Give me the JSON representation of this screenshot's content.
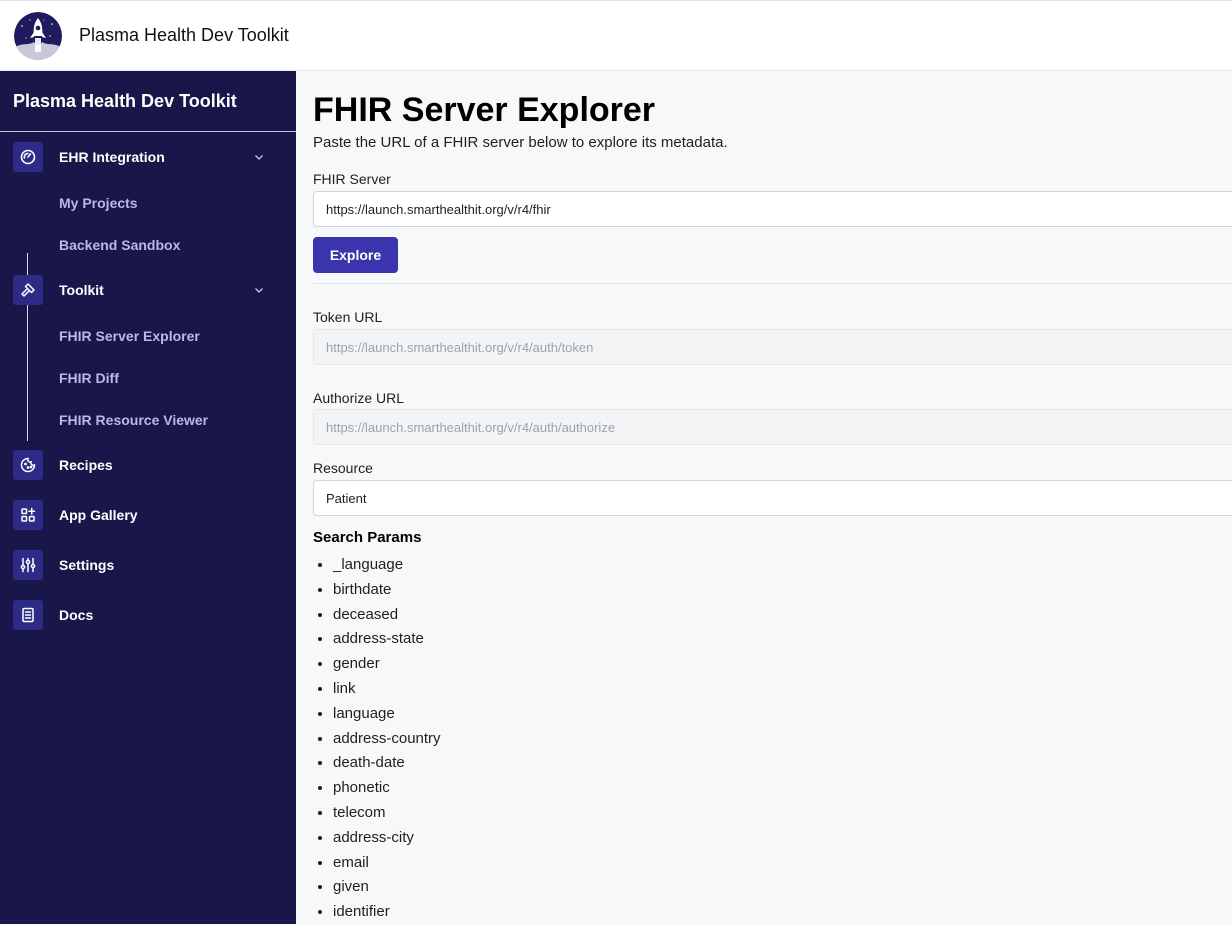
{
  "topbar": {
    "title": "Plasma Health Dev Toolkit",
    "logo_icon": "rocket-logo-icon"
  },
  "sidebar": {
    "brand": "Plasma Health Dev Toolkit",
    "groups": [
      {
        "label": "EHR Integration",
        "icon": "gauge-icon",
        "expanded": true,
        "children": [
          {
            "label": "My Projects"
          },
          {
            "label": "Backend Sandbox"
          }
        ]
      },
      {
        "label": "Toolkit",
        "icon": "hammer-icon",
        "expanded": true,
        "children": [
          {
            "label": "FHIR Server Explorer"
          },
          {
            "label": "FHIR Diff"
          },
          {
            "label": "FHIR Resource Viewer"
          }
        ]
      }
    ],
    "items": [
      {
        "label": "Recipes",
        "icon": "cookie-icon"
      },
      {
        "label": "App Gallery",
        "icon": "grid-plus-icon"
      },
      {
        "label": "Settings",
        "icon": "sliders-icon"
      },
      {
        "label": "Docs",
        "icon": "document-icon"
      }
    ]
  },
  "main": {
    "title": "FHIR Server Explorer",
    "subtitle": "Paste the URL of a FHIR server below to explore its metadata.",
    "fhir_server": {
      "label": "FHIR Server",
      "value": "https://launch.smarthealthit.org/v/r4/fhir"
    },
    "explore_label": "Explore",
    "token_url": {
      "label": "Token URL",
      "value": "https://launch.smarthealthit.org/v/r4/auth/token"
    },
    "authorize_url": {
      "label": "Authorize URL",
      "value": "https://launch.smarthealthit.org/v/r4/auth/authorize"
    },
    "resource": {
      "label": "Resource",
      "value": "Patient"
    },
    "search_params_title": "Search Params",
    "search_params": [
      "_language",
      "birthdate",
      "deceased",
      "address-state",
      "gender",
      "link",
      "language",
      "address-country",
      "death-date",
      "phonetic",
      "telecom",
      "address-city",
      "email",
      "given",
      "identifier"
    ]
  },
  "colors": {
    "sidebar_bg": "#19174a",
    "icon_bg": "#2e2b87",
    "accent": "#3b35ad",
    "sub_item_text": "#b8b8ea"
  }
}
